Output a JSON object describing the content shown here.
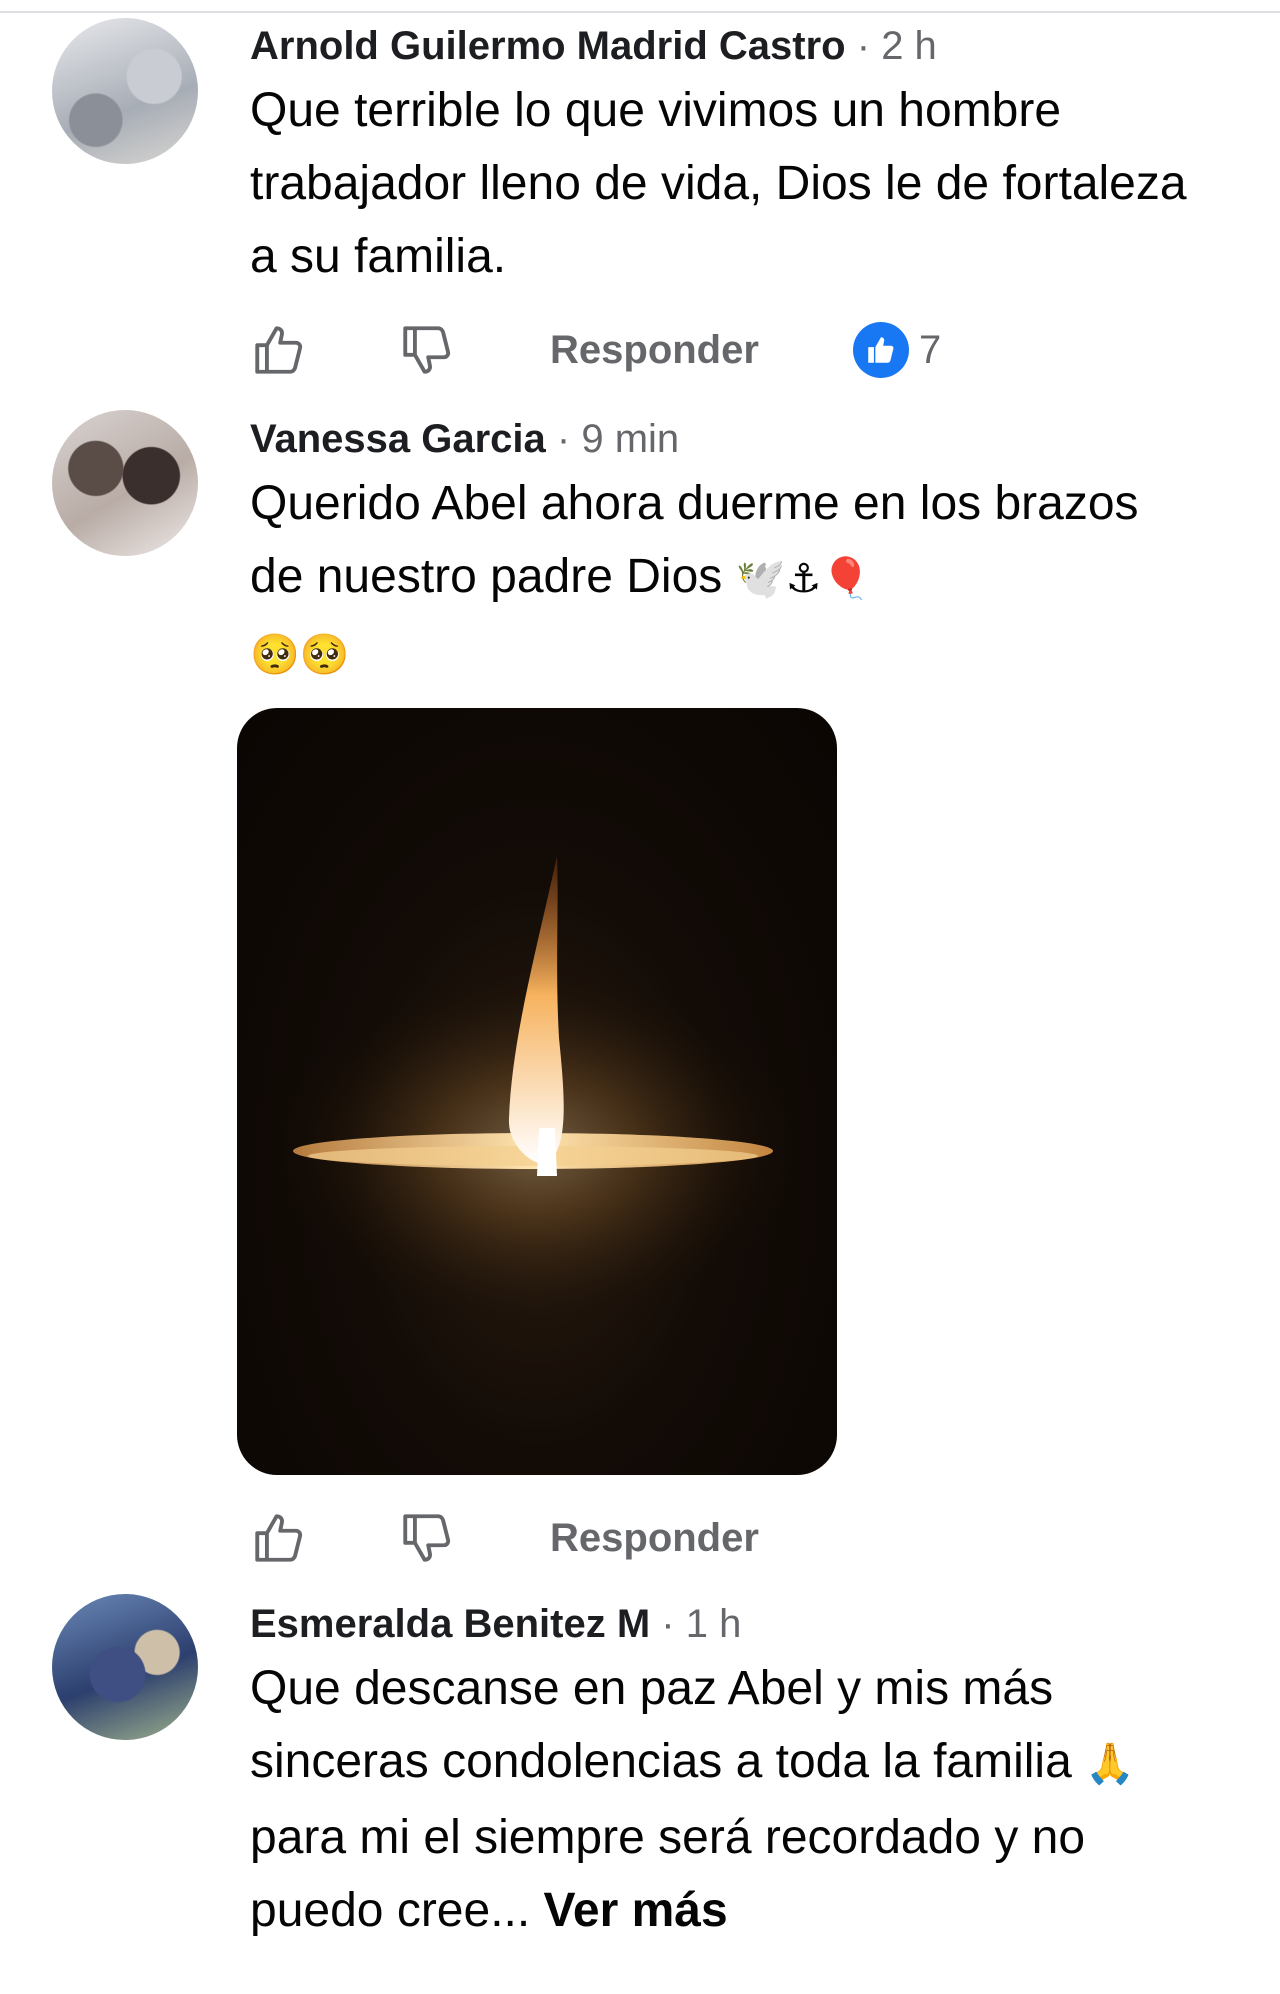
{
  "comments": [
    {
      "author": "Arnold Guilermo Madrid Castro",
      "time": "2 h",
      "text": "Que terrible lo que vivimos un hombre trabajador lleno de vida, Dios le de fortaleza a su familia.",
      "reply_label": "Responder",
      "like_count": "7"
    },
    {
      "author": "Vanessa Garcia",
      "time": "9 min",
      "text": "Querido Abel ahora duerme en los brazos de nuestro padre Dios",
      "emojis_inline": "🕊️⚓🎈",
      "emojis_line2": "🥺🥺",
      "reply_label": "Responder"
    },
    {
      "author": "Esmeralda Benitez M",
      "time": "1 h",
      "text_part1": "Que descanse en paz Abel y mis más sinceras condolencias a toda la familia",
      "emoji": "🙏",
      "text_part2": "para mi el siempre será recordado y no puedo cree...",
      "see_more": "Ver más"
    }
  ],
  "separator": "·",
  "icons": [
    "like-outline-icon",
    "dislike-outline-icon",
    "like-reaction-icon",
    "candle-image"
  ],
  "colors": {
    "like_blue": "#1877f2",
    "meta_gray": "#65676b"
  }
}
